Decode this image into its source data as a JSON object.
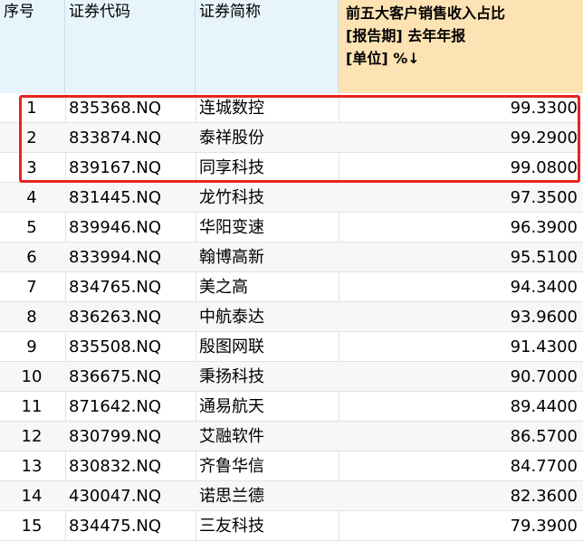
{
  "table": {
    "columns": {
      "index": "序号",
      "code": "证券代码",
      "name": "证券简称",
      "metric_lines": [
        "前五大客户销售收入占比",
        "[报告期] 去年年报",
        "[单位] %↓"
      ]
    },
    "rows": [
      {
        "index": "1",
        "code": "835368.NQ",
        "name": "连城数控",
        "value": "99.3300"
      },
      {
        "index": "2",
        "code": "833874.NQ",
        "name": "泰祥股份",
        "value": "99.2900"
      },
      {
        "index": "3",
        "code": "839167.NQ",
        "name": "同享科技",
        "value": "99.0800"
      },
      {
        "index": "4",
        "code": "831445.NQ",
        "name": "龙竹科技",
        "value": "97.3500"
      },
      {
        "index": "5",
        "code": "839946.NQ",
        "name": "华阳变速",
        "value": "96.3900"
      },
      {
        "index": "6",
        "code": "833994.NQ",
        "name": "翰博高新",
        "value": "95.5100"
      },
      {
        "index": "7",
        "code": "834765.NQ",
        "name": "美之高",
        "value": "94.3400"
      },
      {
        "index": "8",
        "code": "836263.NQ",
        "name": "中航泰达",
        "value": "93.9600"
      },
      {
        "index": "9",
        "code": "835508.NQ",
        "name": "殷图网联",
        "value": "91.4300"
      },
      {
        "index": "10",
        "code": "836675.NQ",
        "name": "秉扬科技",
        "value": "90.7000"
      },
      {
        "index": "11",
        "code": "871642.NQ",
        "name": "通易航天",
        "value": "89.4400"
      },
      {
        "index": "12",
        "code": "830799.NQ",
        "name": "艾融软件",
        "value": "86.5700"
      },
      {
        "index": "13",
        "code": "830832.NQ",
        "name": "齐鲁华信",
        "value": "84.7700"
      },
      {
        "index": "14",
        "code": "430047.NQ",
        "name": "诺思兰德",
        "value": "82.3600"
      },
      {
        "index": "15",
        "code": "834475.NQ",
        "name": "三友科技",
        "value": "79.3900"
      }
    ]
  },
  "colors": {
    "header_bg": "#e8f4fc",
    "sorted_header_bg": "#fde2b3",
    "alt_row_bg": "#f7f7f7",
    "highlight_border": "#e8221e"
  }
}
